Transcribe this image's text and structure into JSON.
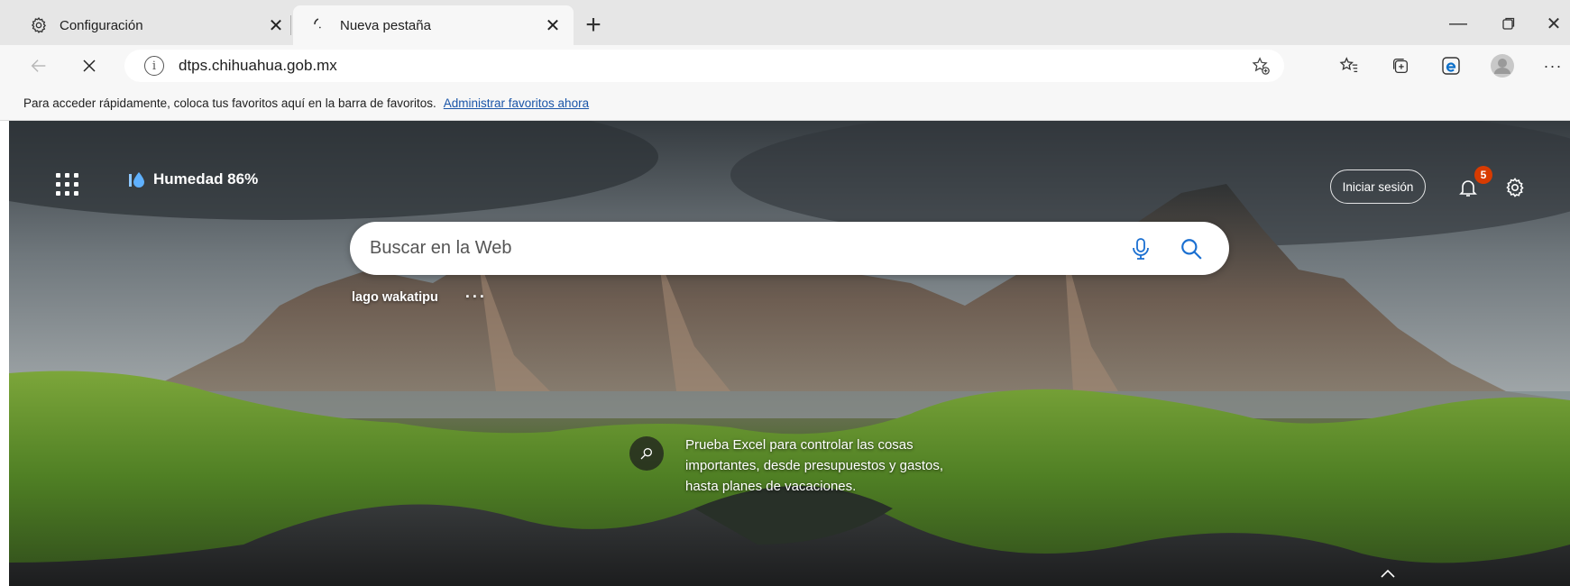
{
  "tabs": [
    {
      "label": "Configuración",
      "icon": "gear-icon"
    },
    {
      "label": "Nueva pestaña",
      "icon": "loading-spinner-icon",
      "active": true
    }
  ],
  "toolbar": {
    "url": "dtps.chihuahua.gob.mx"
  },
  "favorites_bar": {
    "message": "Para acceder rápidamente, coloca tus favoritos aquí en la barra de favoritos.",
    "link": "Administrar favoritos ahora"
  },
  "page": {
    "weather": "Humedad 86%",
    "signin": "Iniciar sesión",
    "notifications_count": "5",
    "search_placeholder": "Buscar en la Web",
    "image_caption": "lago wakatipu",
    "image_more": "···",
    "promo_text": "Prueba Excel para controlar las cosas importantes, desde presupuestos y gastos, hasta planes de vacaciones."
  },
  "colors": {
    "tabstrip": "#e6e6e6",
    "toolbar": "#f7f7f7",
    "link": "#1a55a8",
    "badge": "#d83b01",
    "edge_blue": "#0b6fc9"
  }
}
